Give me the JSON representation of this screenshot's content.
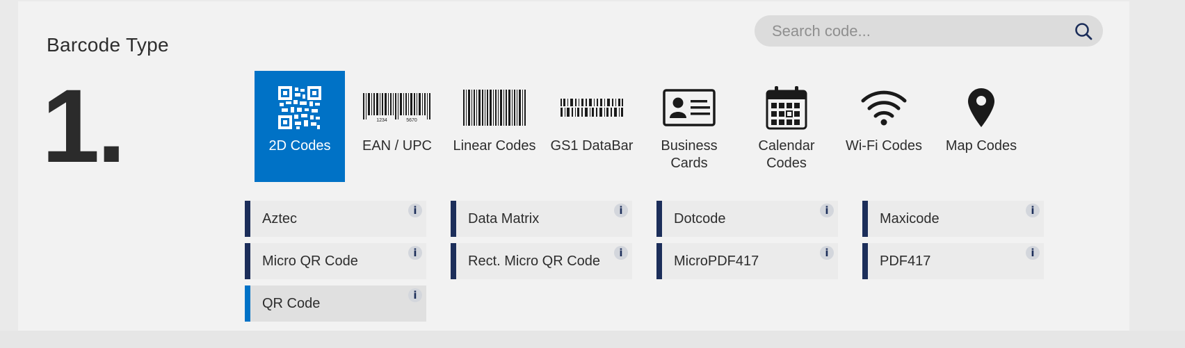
{
  "section": {
    "title": "Barcode Type",
    "step_number": "1."
  },
  "search": {
    "placeholder": "Search code..."
  },
  "barcode_types": [
    {
      "label": "2D Codes",
      "icon": "qr-code-icon",
      "active": true
    },
    {
      "label": "EAN / UPC",
      "icon": "ean-barcode-icon",
      "icon_text": [
        "1234",
        "5670"
      ]
    },
    {
      "label": "Linear Codes",
      "icon": "linear-barcode-icon"
    },
    {
      "label": "GS1 DataBar",
      "icon": "databar-icon"
    },
    {
      "label": "Business Cards",
      "icon": "business-card-icon"
    },
    {
      "label": "Calendar Codes",
      "icon": "calendar-icon"
    },
    {
      "label": "Wi-Fi Codes",
      "icon": "wifi-icon"
    },
    {
      "label": "Map Codes",
      "icon": "map-pin-icon"
    }
  ],
  "codes": [
    {
      "label": "Aztec",
      "info": "i"
    },
    {
      "label": "Data Matrix",
      "info": "i"
    },
    {
      "label": "Dotcode",
      "info": "i"
    },
    {
      "label": "Maxicode",
      "info": "i"
    },
    {
      "label": "Micro QR Code",
      "info": "i"
    },
    {
      "label": "Rect. Micro QR Code",
      "info": "i"
    },
    {
      "label": "MicroPDF417",
      "info": "i"
    },
    {
      "label": "PDF417",
      "info": "i"
    },
    {
      "label": "QR Code",
      "info": "i",
      "selected": true
    }
  ],
  "colors": {
    "accent": "#0072c6",
    "code_border": "#1c2e5a",
    "panel_bg": "#f2f2f2"
  }
}
